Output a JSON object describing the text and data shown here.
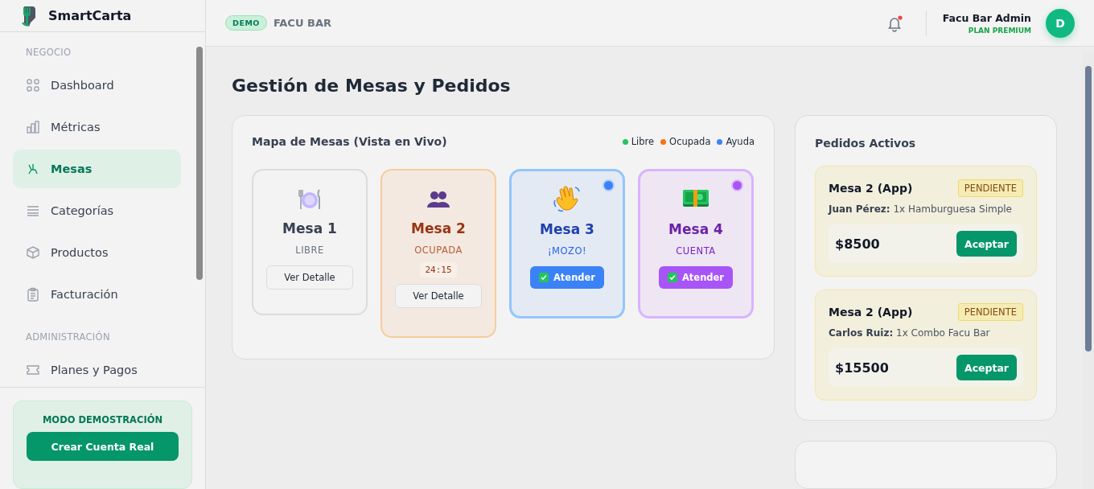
{
  "brand": {
    "name": "SmartCarta"
  },
  "header": {
    "badge": "DEMO",
    "business": "FACU BAR",
    "has_notification": true,
    "user_name": "Facu Bar Admin",
    "plan": "PLAN PREMIUM",
    "avatar": "D"
  },
  "sidebar": {
    "sections": [
      {
        "title": "NEGOCIO",
        "items": [
          {
            "label": "Dashboard",
            "kind": "grid",
            "selected": false
          },
          {
            "label": "Métricas",
            "kind": "bars",
            "selected": false
          },
          {
            "label": "Mesas",
            "kind": "table",
            "selected": true
          },
          {
            "label": "Categorías",
            "kind": "list",
            "selected": false
          },
          {
            "label": "Productos",
            "kind": "box",
            "selected": false
          },
          {
            "label": "Facturación",
            "kind": "clipboard",
            "selected": false
          }
        ]
      },
      {
        "title": "ADMINISTRACIÓN",
        "items": [
          {
            "label": "Planes y Pagos",
            "kind": "ticket",
            "selected": false
          }
        ]
      }
    ],
    "demo": {
      "title": "MODO DEMOSTRACIÓN",
      "button": "Crear Cuenta Real"
    }
  },
  "page_title": "Gestión de Mesas y Pedidos",
  "map": {
    "title": "Mapa de Mesas (Vista en Vivo)",
    "legend": [
      {
        "label": "Libre",
        "color": "#22c55e"
      },
      {
        "label": "Ocupada",
        "color": "#f97316"
      },
      {
        "label": "Ayuda",
        "color": "#3b82f6"
      }
    ],
    "tables": [
      {
        "kind": "libre",
        "name": "Mesa 1",
        "status": "LIBRE",
        "button": "Ver Detalle"
      },
      {
        "kind": "ocupada",
        "name": "Mesa 2",
        "status": "OCUPADA",
        "timer": "24:15",
        "button": "Ver Detalle"
      },
      {
        "kind": "ayuda",
        "name": "Mesa 3",
        "status": "¡MOZO!",
        "button": "Atender"
      },
      {
        "kind": "cuenta",
        "name": "Mesa 4",
        "status": "CUENTA",
        "button": "Atender"
      }
    ]
  },
  "orders": {
    "title": "Pedidos Activos",
    "items": [
      {
        "table": "Mesa 2 (App)",
        "status": "PENDIENTE",
        "customer": "Juan Pérez:",
        "items": "1x Hamburguesa Simple",
        "total": "$8500",
        "button": "Aceptar"
      },
      {
        "table": "Mesa 2 (App)",
        "status": "PENDIENTE",
        "customer": "Carlos Ruiz:",
        "items": "1x Combo Facu Bar",
        "total": "$15500",
        "button": "Aceptar"
      }
    ]
  }
}
